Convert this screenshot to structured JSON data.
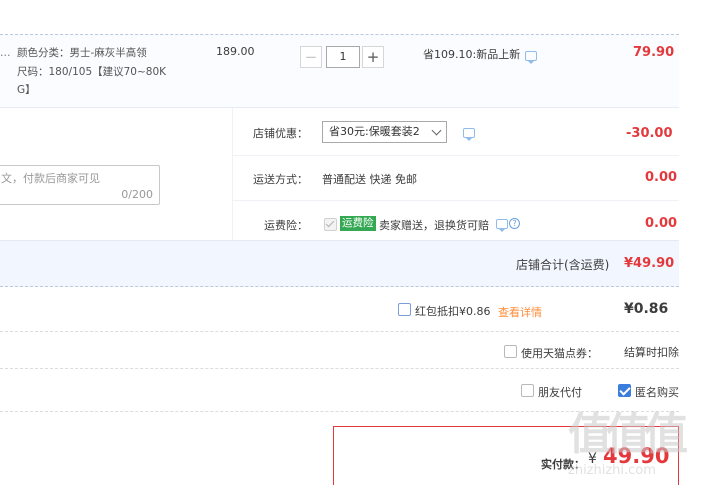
{
  "item": {
    "sku_color": "颜色分类：男士-麻灰半高领",
    "sku_size_line1": "尺码：180/105【建议70~80K",
    "sku_size_line2": "G】",
    "truncated_left": "…",
    "unit_price": "189.00",
    "qty_minus": "−",
    "qty_value": "1",
    "qty_plus": "+",
    "discount_text": "省109.10:新品上新",
    "subtotal": "79.90"
  },
  "shop": {
    "coupon_label": "店铺优惠：",
    "coupon_selected": "省30元:保暖套装2",
    "coupon_amount": "-30.00",
    "message_placeholder": "文，付款后商家可见",
    "message_counter": "0/200",
    "shipping_label": "运送方式：",
    "shipping_value": "普通配送 快递 免邮",
    "shipping_amount": "0.00",
    "insurance_label": "运费险：",
    "insurance_tag": "运费险",
    "insurance_desc": "卖家赠送，退换货可赔",
    "insurance_amount": "0.00",
    "total_label": "店铺合计(含运费)",
    "total_value": "¥49.90"
  },
  "options": {
    "redpacket_label": "红包抵扣¥0.86",
    "redpacket_link": "查看详情",
    "redpacket_amount": "¥0.86",
    "tmall_points_label": "使用天猫点券：",
    "tmall_points_value": "结算时扣除",
    "friend_pay_label": "朋友代付",
    "anonymous_label": "匿名购买"
  },
  "payment": {
    "label": "实付款：",
    "currency": "¥",
    "amount": "49.90"
  },
  "watermark": {
    "logo": "值值值",
    "url": "zhizhizhi.com"
  },
  "colors": {
    "accent_red": "#e4393c",
    "link_orange": "#ff8c3a",
    "checkbox_blue": "#3b7ddd",
    "insurance_green": "#34a853"
  }
}
